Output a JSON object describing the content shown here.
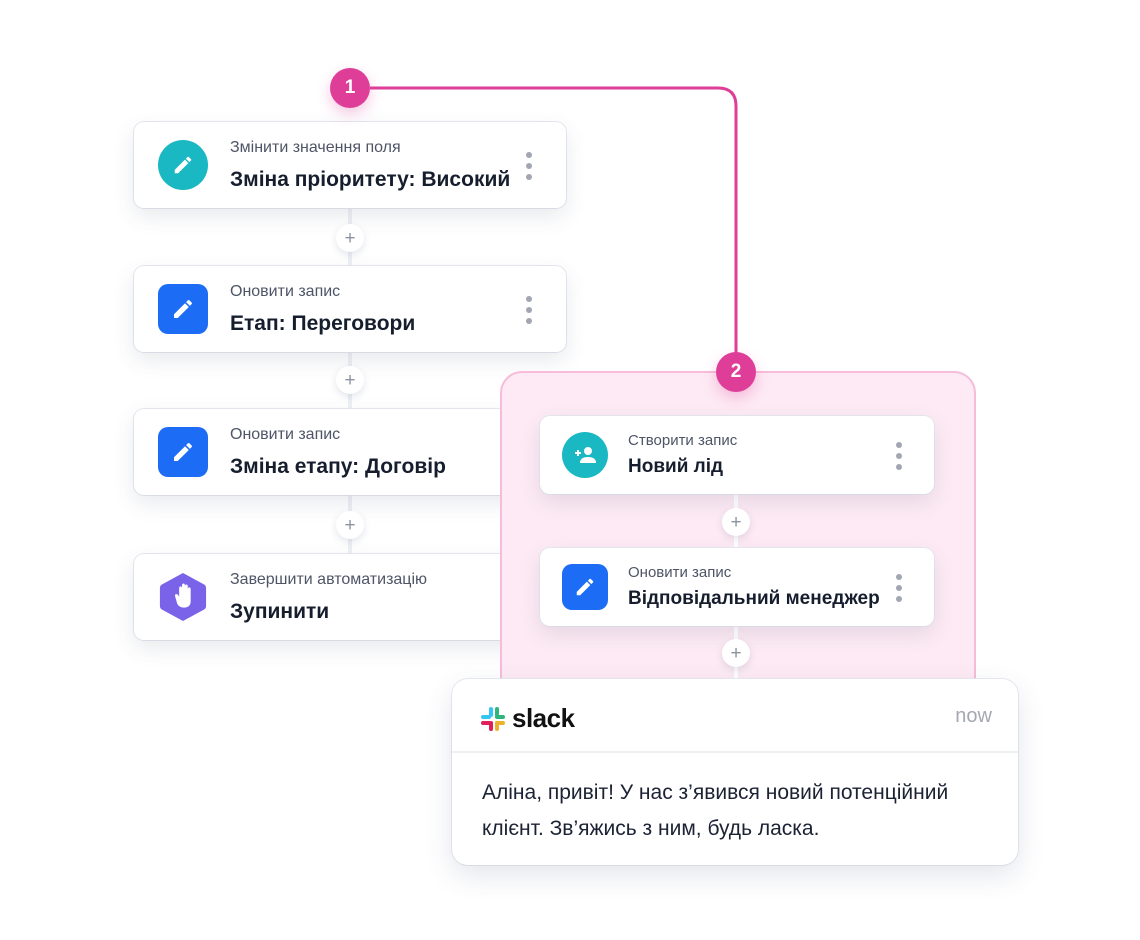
{
  "colors": {
    "accent_pink": "#df3e98",
    "branch_bg": "#fdeaf4",
    "teal": "#1ab8c2",
    "blue": "#1c6cf6",
    "purple": "#7a63e8"
  },
  "badges": [
    "1",
    "2"
  ],
  "main_flow": [
    {
      "icon": "pencil-icon",
      "icon_shape": "circle",
      "subtitle": "Змінити значення поля",
      "title": "Зміна пріоритету: Високий"
    },
    {
      "icon": "pencil-icon",
      "icon_shape": "square",
      "subtitle": "Оновити запис",
      "title": "Етап: Переговори"
    },
    {
      "icon": "pencil-icon",
      "icon_shape": "square",
      "subtitle": "Оновити запис",
      "title": "Зміна етапу: Договір"
    },
    {
      "icon": "hand-stop-icon",
      "icon_shape": "hexagon",
      "subtitle": "Завершити автоматизацію",
      "title": "Зупинити"
    }
  ],
  "branch_flow": [
    {
      "icon": "add-user-icon",
      "icon_shape": "circle",
      "subtitle": "Створити запис",
      "title": "Новий лід"
    },
    {
      "icon": "pencil-icon",
      "icon_shape": "square",
      "subtitle": "Оновити запис",
      "title": "Відповідальний менеджер"
    }
  ],
  "add_step_label": "+",
  "slack": {
    "app_name": "slack",
    "time": "now",
    "message": "Аліна, привіт! У нас з’явився новий потенційний клієнт. Зв’яжись з ним, будь ласка."
  }
}
